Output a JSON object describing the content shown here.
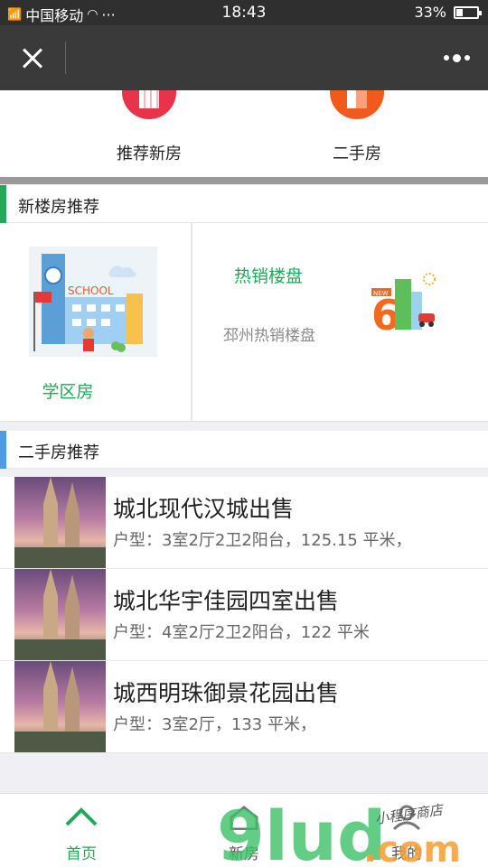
{
  "status_bar": {
    "carrier": "中国移动",
    "extra": "···",
    "time": "18:43",
    "battery": "33%",
    "battery_level": 0.33
  },
  "titlebar": {
    "close_icon": "close-icon",
    "more_icon": "more-icon"
  },
  "quick_nav": [
    {
      "label": "推荐新房",
      "icon": "building-icon",
      "color": "#e8334a"
    },
    {
      "label": "二手房",
      "icon": "house-icon",
      "color": "#f25a1c"
    }
  ],
  "new_section": {
    "title": "新楼房推荐",
    "accent": "#21a858",
    "school": {
      "label": "学区房",
      "sign": "SCHOOL",
      "icon": "school-illustration"
    },
    "hot": {
      "title": "热销楼盘",
      "subtitle": "邳州热销楼盘",
      "icon": "new-building-illustration",
      "badge": "NEW"
    }
  },
  "second_section": {
    "title": "二手房推荐",
    "accent": "#4a9be8",
    "listings": [
      {
        "title": "城北现代汉城出售",
        "desc": "户型：3室2厅2卫2阳台，125.15 平米，"
      },
      {
        "title": "城北华宇佳园四室出售",
        "desc": "户型：4室2厅2卫2阳台，122 平米"
      },
      {
        "title": "城西明珠御景花园出售",
        "desc": "户型：3室2厅，133 平米，"
      }
    ]
  },
  "tabbar": [
    {
      "label": "首页",
      "icon": "home-chevron-icon",
      "active": true
    },
    {
      "label": "新房",
      "icon": "new-house-icon",
      "active": false
    },
    {
      "label": "我的",
      "icon": "user-icon",
      "active": false
    }
  ],
  "watermark": {
    "brand": "9lud",
    "suffix": ".com",
    "tagline": "小程序商店"
  }
}
